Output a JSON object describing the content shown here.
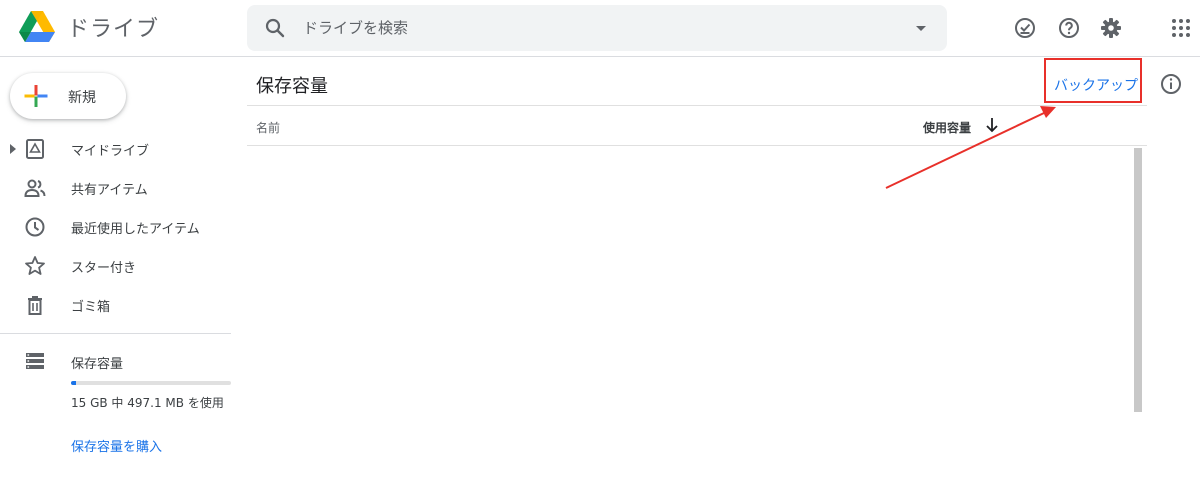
{
  "header": {
    "app_title": "ドライブ",
    "search_placeholder": "ドライブを検索"
  },
  "sidebar": {
    "new_label": "新規",
    "items": [
      {
        "label": "マイドライブ"
      },
      {
        "label": "共有アイテム"
      },
      {
        "label": "最近使用したアイテム"
      },
      {
        "label": "スター付き"
      },
      {
        "label": "ゴミ箱"
      }
    ],
    "storage": {
      "label": "保存容量",
      "usage_text": "15 GB 中 497.1 MB を使用",
      "used_fraction": 0.033,
      "buy_label": "保存容量を購入"
    }
  },
  "main": {
    "title": "保存容量",
    "backup_label": "バックアップ",
    "columns": {
      "name": "名前",
      "size": "使用容量"
    }
  },
  "colors": {
    "accent": "#1a73e8",
    "annotation": "#e8302a"
  }
}
